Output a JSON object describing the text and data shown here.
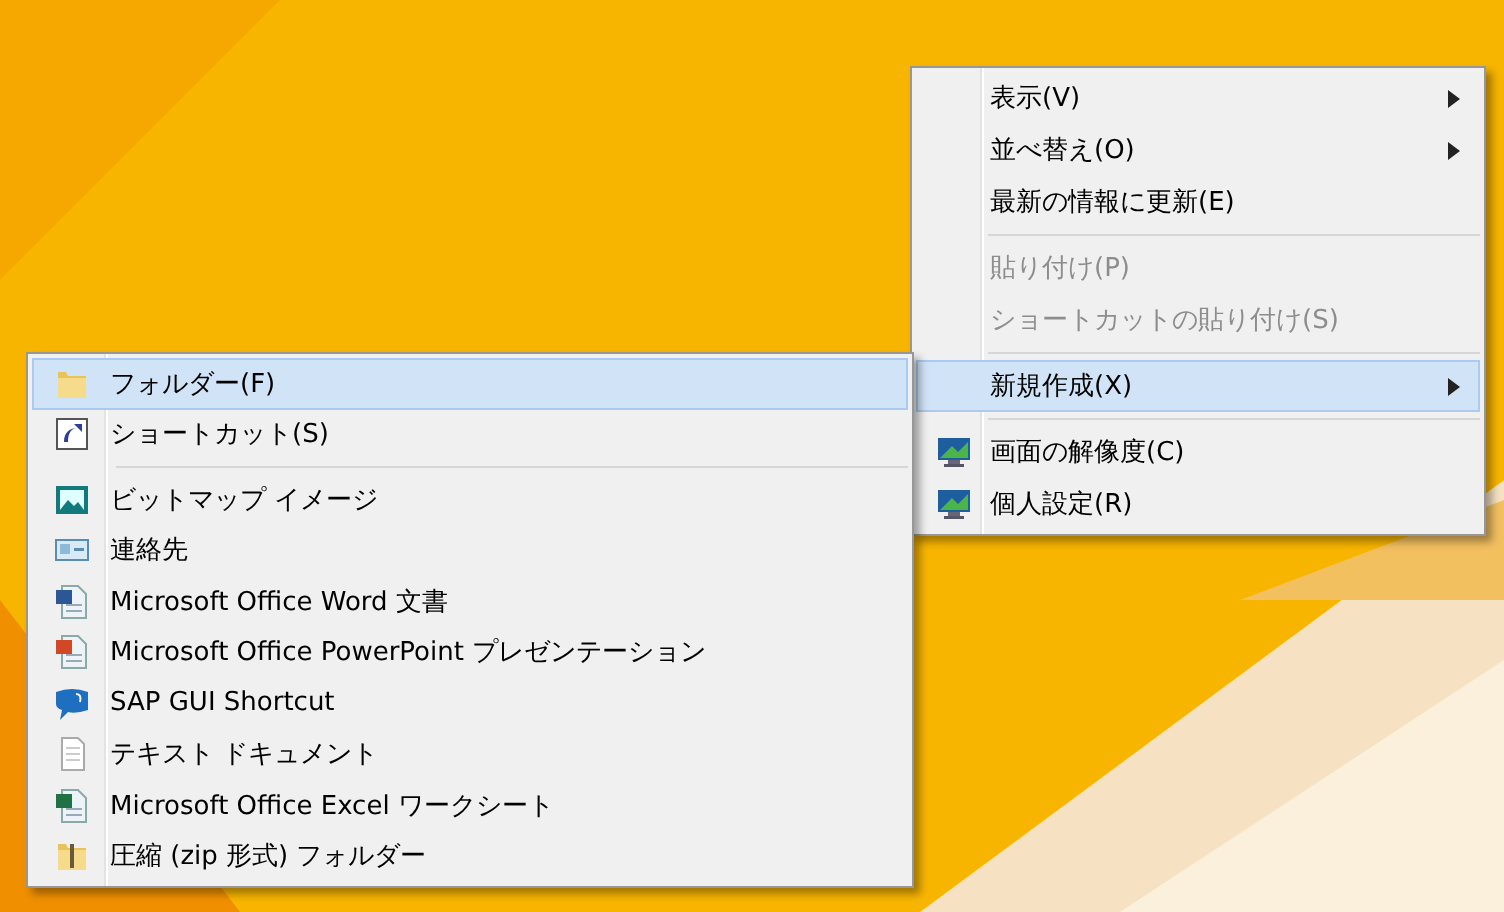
{
  "context_menu": {
    "items": [
      {
        "kind": "plain",
        "label": "表示(V)",
        "submenu": true,
        "disabled": false,
        "selected": false
      },
      {
        "kind": "plain",
        "label": "並べ替え(O)",
        "submenu": true,
        "disabled": false,
        "selected": false
      },
      {
        "kind": "plain",
        "label": "最新の情報に更新(E)",
        "submenu": false,
        "disabled": false,
        "selected": false
      },
      {
        "kind": "separator"
      },
      {
        "kind": "plain",
        "label": "貼り付け(P)",
        "submenu": false,
        "disabled": true,
        "selected": false
      },
      {
        "kind": "plain",
        "label": "ショートカットの貼り付け(S)",
        "submenu": false,
        "disabled": true,
        "selected": false
      },
      {
        "kind": "separator"
      },
      {
        "kind": "plain",
        "label": "新規作成(X)",
        "submenu": true,
        "disabled": false,
        "selected": true
      },
      {
        "kind": "separator"
      },
      {
        "kind": "display",
        "label": "画面の解像度(C)",
        "submenu": false,
        "disabled": false,
        "selected": false
      },
      {
        "kind": "display",
        "label": "個人設定(R)",
        "submenu": false,
        "disabled": false,
        "selected": false
      }
    ]
  },
  "new_submenu": {
    "items": [
      {
        "kind": "folder",
        "label": "フォルダー(F)",
        "selected": true
      },
      {
        "kind": "shortcut",
        "label": "ショートカット(S)",
        "selected": false
      },
      {
        "kind": "separator"
      },
      {
        "kind": "bitmap",
        "label": "ビットマップ イメージ",
        "selected": false
      },
      {
        "kind": "contact",
        "label": "連絡先",
        "selected": false
      },
      {
        "kind": "word",
        "label": "Microsoft Office Word 文書",
        "selected": false
      },
      {
        "kind": "powerpoint",
        "label": "Microsoft Office PowerPoint プレゼンテーション",
        "selected": false
      },
      {
        "kind": "sap",
        "label": "SAP GUI Shortcut",
        "selected": false
      },
      {
        "kind": "text",
        "label": "テキスト ドキュメント",
        "selected": false
      },
      {
        "kind": "excel",
        "label": "Microsoft Office Excel ワークシート",
        "selected": false
      },
      {
        "kind": "zip",
        "label": "圧縮 (zip 形式) フォルダー",
        "selected": false
      }
    ]
  }
}
